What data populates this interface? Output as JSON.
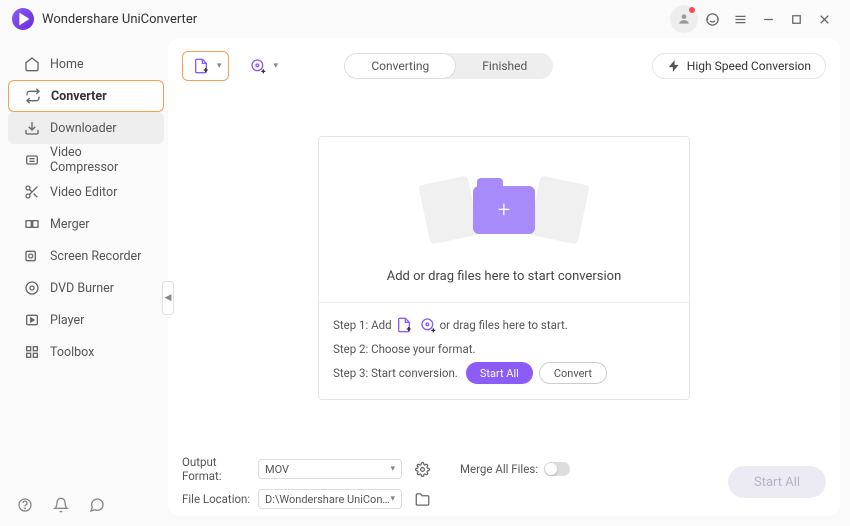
{
  "app": {
    "title": "Wondershare UniConverter"
  },
  "sidebar": {
    "items": [
      {
        "label": "Home"
      },
      {
        "label": "Converter"
      },
      {
        "label": "Downloader"
      },
      {
        "label": "Video Compressor"
      },
      {
        "label": "Video Editor"
      },
      {
        "label": "Merger"
      },
      {
        "label": "Screen Recorder"
      },
      {
        "label": "DVD Burner"
      },
      {
        "label": "Player"
      },
      {
        "label": "Toolbox"
      }
    ]
  },
  "tabs": {
    "converting": "Converting",
    "finished": "Finished"
  },
  "speed": {
    "label": "High Speed Conversion"
  },
  "dropzone": {
    "headline": "Add or drag files here to start conversion",
    "step1_pre": "Step 1: Add",
    "step1_post": "or drag files here to start.",
    "step2": "Step 2: Choose your format.",
    "step3": "Step 3: Start conversion.",
    "start_all": "Start All",
    "convert": "Convert"
  },
  "footer": {
    "output_format_label": "Output Format:",
    "output_format_value": "MOV",
    "file_location_label": "File Location:",
    "file_location_value": "D:\\Wondershare UniConverter",
    "merge_label": "Merge All Files:",
    "start_all": "Start All"
  }
}
